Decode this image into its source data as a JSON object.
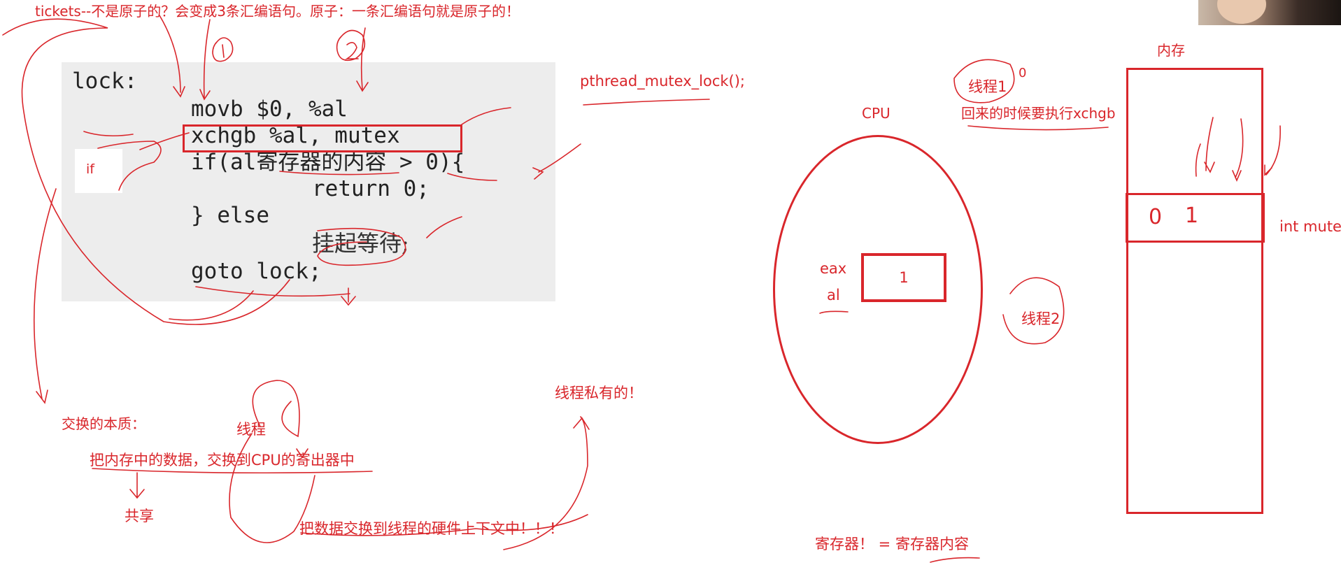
{
  "header_note": "tickets--不是原子的？会变成3条汇编语句。原子：一条汇编语句就是原子的！",
  "circled_marks": [
    "1",
    "2"
  ],
  "code": {
    "lines": [
      "lock:",
      "movb $0, %al",
      "xchgb %al, mutex",
      "if(al寄存器的内容 > 0){",
      "return 0;",
      "} else",
      "挂起等待;",
      "goto lock;"
    ],
    "if_label": "if"
  },
  "notes": {
    "pthread_call": "pthread_mutex_lock();",
    "swap_essence": "交换的本质：",
    "thread_word": "线程",
    "swap_desc": "把内存中的数据，交换到CPU的寄出器中",
    "shared": "共享",
    "thread_private": "线程私有的！",
    "swap_to_context": "把数据交换到线程的硬件上下文中！！！",
    "register_vs_content": "寄存器！ = 寄存器内容"
  },
  "cpu": {
    "label": "CPU",
    "reg_eax": "eax",
    "reg_al": "al",
    "al_value": "1",
    "thread1": "线程1",
    "thread1_mark": "0",
    "thread1_note": "回来的时候要执行xchgb",
    "thread2": "线程2"
  },
  "memory": {
    "label": "内存",
    "cell_value_old": "0",
    "cell_value_new": "1",
    "cell_label": "int mutex"
  },
  "colors": {
    "ink_red": "#d9262b",
    "code_panel": "#ededed",
    "code_text": "#222222"
  }
}
